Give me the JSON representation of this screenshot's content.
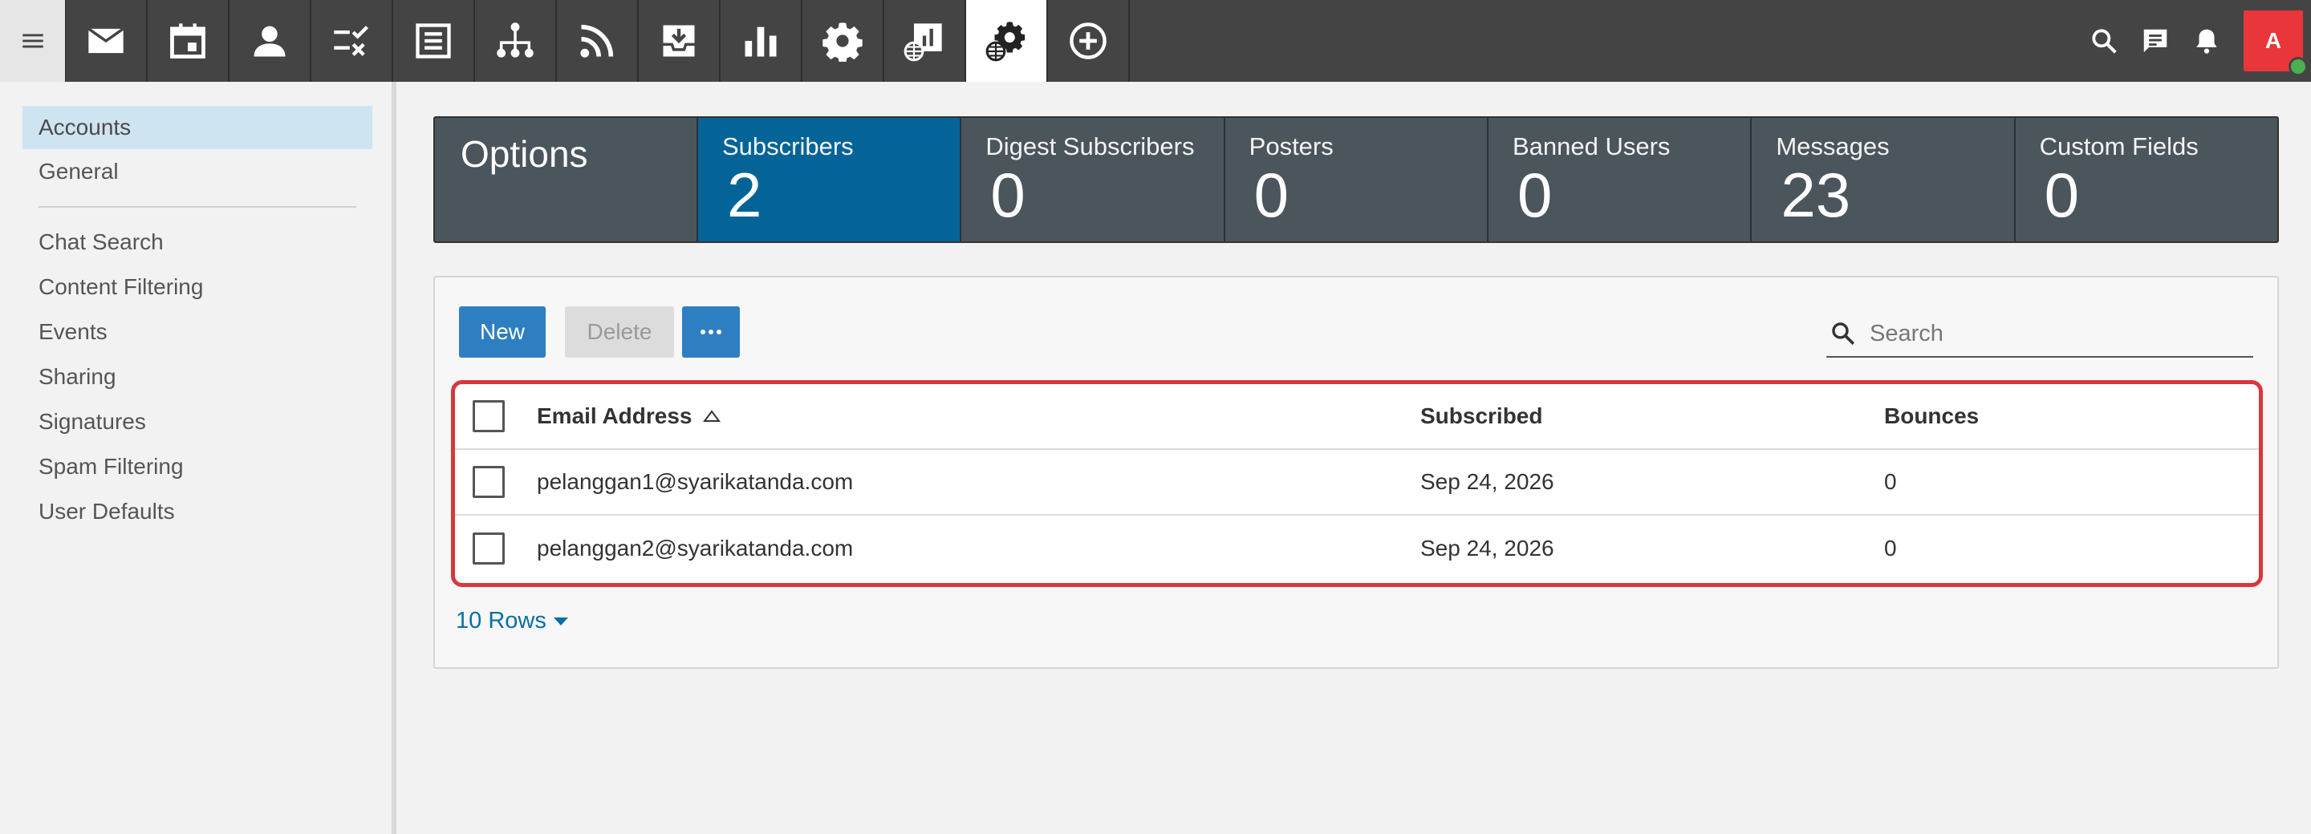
{
  "topbar": {
    "menu_icon": "hamburger-icon",
    "apps": [
      {
        "name": "mail",
        "icon": "envelope-icon"
      },
      {
        "name": "calendar",
        "icon": "calendar-icon"
      },
      {
        "name": "contacts",
        "icon": "person-icon"
      },
      {
        "name": "tasks",
        "icon": "tasks-icon"
      },
      {
        "name": "notes",
        "icon": "notes-icon"
      },
      {
        "name": "org-chart",
        "icon": "org-chart-icon"
      },
      {
        "name": "feeds",
        "icon": "rss-icon"
      },
      {
        "name": "archive",
        "icon": "download-tray-icon"
      },
      {
        "name": "reports",
        "icon": "bar-chart-icon"
      },
      {
        "name": "settings",
        "icon": "gear-icon"
      },
      {
        "name": "domain-reports",
        "icon": "globe-report-icon"
      },
      {
        "name": "domain-settings",
        "icon": "globe-gear-icon",
        "active": true
      },
      {
        "name": "add",
        "icon": "plus-circle-icon"
      }
    ],
    "right_icons": [
      "search-icon",
      "chat-icon",
      "bell-icon"
    ],
    "avatar_letter": "A",
    "avatar_color": "#e8363a",
    "presence_color": "#4caf50"
  },
  "sidebar": {
    "items": [
      {
        "label": "Accounts",
        "selected": true
      },
      {
        "label": "General"
      },
      {
        "label": "Chat Search"
      },
      {
        "label": "Content Filtering"
      },
      {
        "label": "Events"
      },
      {
        "label": "Sharing"
      },
      {
        "label": "Signatures"
      },
      {
        "label": "Spam Filtering"
      },
      {
        "label": "User Defaults"
      }
    ]
  },
  "stats": {
    "title": "Options",
    "items": [
      {
        "label": "Subscribers",
        "value": "2",
        "active": true
      },
      {
        "label": "Digest Subscribers",
        "value": "0"
      },
      {
        "label": "Posters",
        "value": "0"
      },
      {
        "label": "Banned Users",
        "value": "0"
      },
      {
        "label": "Messages",
        "value": "23"
      },
      {
        "label": "Custom Fields",
        "value": "0"
      }
    ],
    "active_color": "#046497"
  },
  "toolbar": {
    "new_label": "New",
    "delete_label": "Delete",
    "more_icon": "ellipsis-icon",
    "search_placeholder": "Search"
  },
  "table": {
    "columns": {
      "email": "Email Address",
      "subscribed": "Subscribed",
      "bounces": "Bounces"
    },
    "sort_column": "Email Address",
    "sort_direction": "ascending",
    "rows": [
      {
        "email": "pelanggan1@syarikatanda.com",
        "subscribed": "Sep 24, 2026",
        "bounces": "0"
      },
      {
        "email": "pelanggan2@syarikatanda.com",
        "subscribed": "Sep 24, 2026",
        "bounces": "0"
      }
    ]
  },
  "pagination": {
    "rows_label": "10 Rows"
  }
}
